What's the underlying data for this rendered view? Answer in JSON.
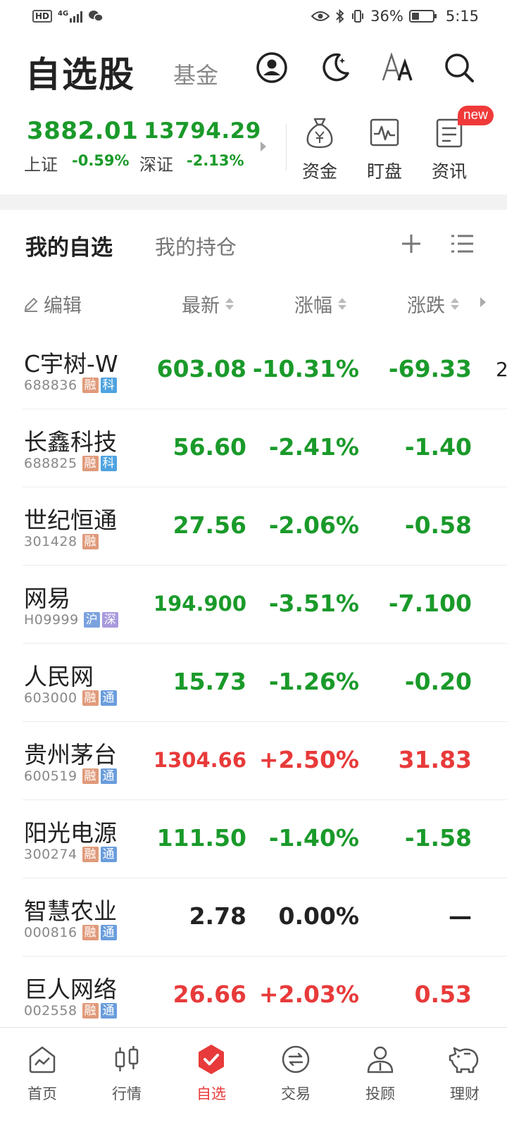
{
  "status": {
    "hd": "HD",
    "net": "4G",
    "battery_text": "36%",
    "battery_level": 0.36,
    "time": "5:15"
  },
  "header": {
    "title": "自选股",
    "fund_tab": "基金"
  },
  "indices": [
    {
      "name": "上证",
      "value": "3882.01",
      "pct": "-0.59%",
      "color": "#1a9a2a"
    },
    {
      "name": "深证",
      "value": "13794.29",
      "pct": "-2.13%",
      "color": "#1a9a2a"
    }
  ],
  "quick_links": [
    {
      "label": "资金",
      "icon": "money-bag-icon"
    },
    {
      "label": "盯盘",
      "icon": "monitor-chart-icon"
    },
    {
      "label": "资讯",
      "icon": "news-icon",
      "badge": "new"
    }
  ],
  "list_tabs": {
    "active": "我的自选",
    "inactive": "我的持仓"
  },
  "columns": {
    "edit": "编辑",
    "last": "最新",
    "pct": "涨幅",
    "chg": "涨跌"
  },
  "stocks": [
    {
      "name": "C宇树-W",
      "code": "688836",
      "tags": [
        "融",
        "科"
      ],
      "last": "603.08",
      "pct": "-10.31%",
      "chg": "-69.33",
      "trend": "down"
    },
    {
      "name": "长鑫科技",
      "code": "688825",
      "tags": [
        "融",
        "科"
      ],
      "last": "56.60",
      "pct": "-2.41%",
      "chg": "-1.40",
      "trend": "down"
    },
    {
      "name": "世纪恒通",
      "code": "301428",
      "tags": [
        "融"
      ],
      "last": "27.56",
      "pct": "-2.06%",
      "chg": "-0.58",
      "trend": "down"
    },
    {
      "name": "网易",
      "code": "H09999",
      "tags": [
        "沪",
        "深"
      ],
      "last": "194.900",
      "pct": "-3.51%",
      "chg": "-7.100",
      "trend": "down"
    },
    {
      "name": "人民网",
      "code": "603000",
      "tags": [
        "融",
        "通"
      ],
      "last": "15.73",
      "pct": "-1.26%",
      "chg": "-0.20",
      "trend": "down"
    },
    {
      "name": "贵州茅台",
      "code": "600519",
      "tags": [
        "融",
        "通"
      ],
      "last": "1304.66",
      "pct": "+2.50%",
      "chg": "31.83",
      "trend": "up"
    },
    {
      "name": "阳光电源",
      "code": "300274",
      "tags": [
        "融",
        "通"
      ],
      "last": "111.50",
      "pct": "-1.40%",
      "chg": "-1.58",
      "trend": "down"
    },
    {
      "name": "智慧农业",
      "code": "000816",
      "tags": [
        "融",
        "通"
      ],
      "last": "2.78",
      "pct": "0.00%",
      "chg": "—",
      "trend": "flat"
    },
    {
      "name": "巨人网络",
      "code": "002558",
      "tags": [
        "融",
        "通"
      ],
      "last": "26.66",
      "pct": "+2.03%",
      "chg": "0.53",
      "trend": "up"
    }
  ],
  "bottom_nav": [
    {
      "label": "首页",
      "icon": "home-icon"
    },
    {
      "label": "行情",
      "icon": "candlestick-icon"
    },
    {
      "label": "自选",
      "icon": "watchlist-icon",
      "active": true
    },
    {
      "label": "交易",
      "icon": "exchange-icon"
    },
    {
      "label": "投顾",
      "icon": "advisor-icon"
    },
    {
      "label": "理财",
      "icon": "piggy-bank-icon"
    }
  ],
  "colors": {
    "up": "#e83a3a",
    "down": "#1a9a2a",
    "flat": "#222222",
    "accent": "#e83a3a"
  }
}
